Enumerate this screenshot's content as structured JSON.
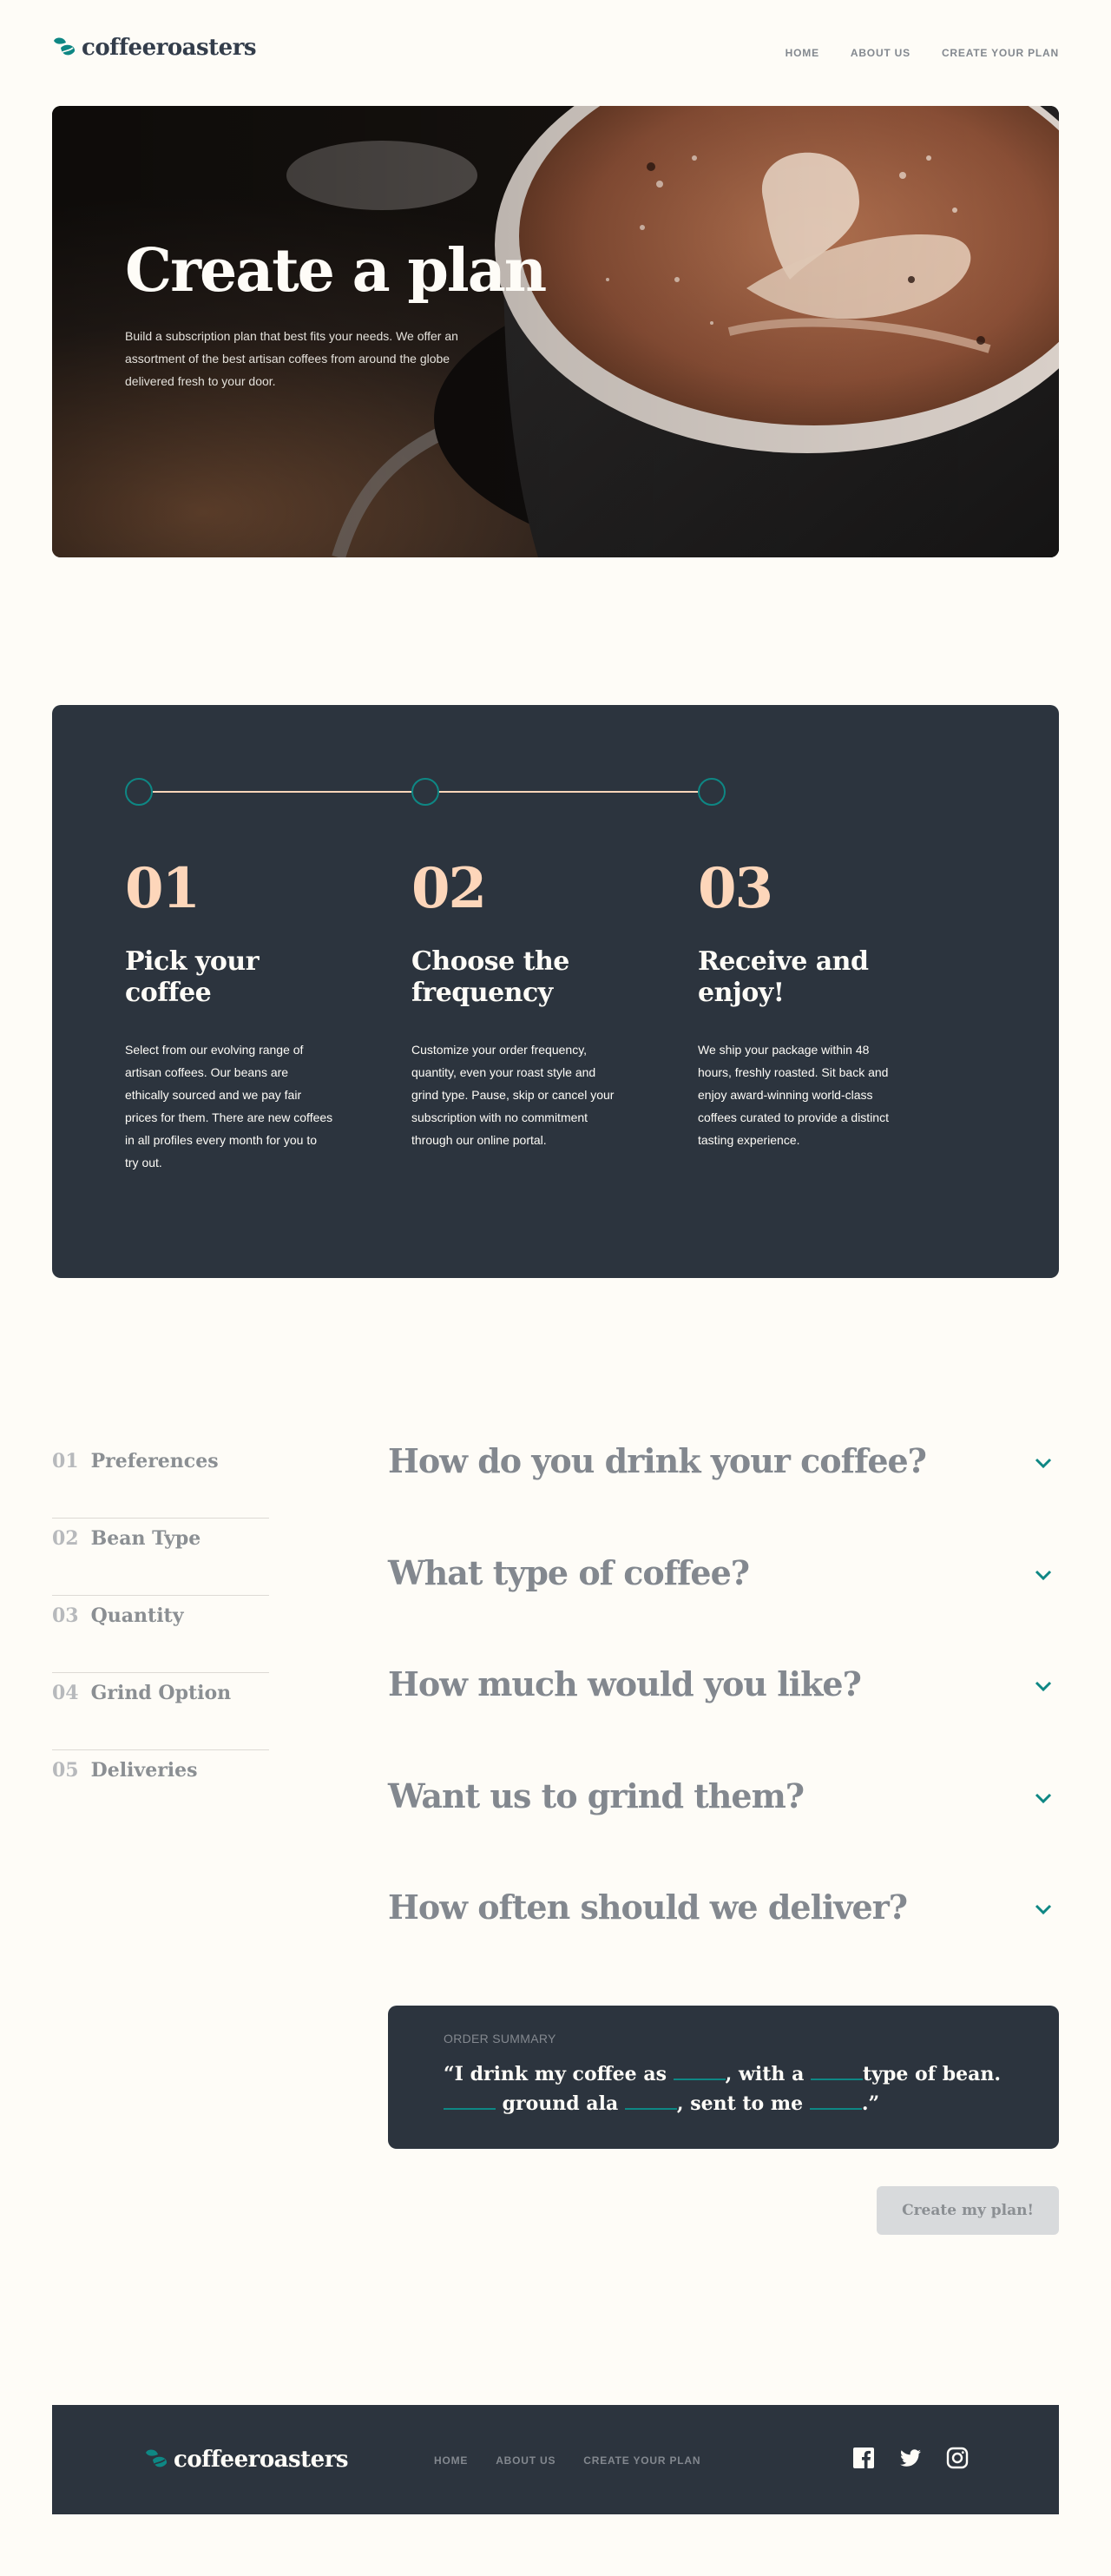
{
  "brand": {
    "name": "coffeeroasters"
  },
  "nav": {
    "home": "HOME",
    "about": "ABOUT US",
    "create": "CREATE YOUR PLAN"
  },
  "hero": {
    "title": "Create a plan",
    "text": "Build a subscription plan that best fits your needs. We offer an assortment of the best artisan coffees from around the globe delivered fresh to your door."
  },
  "steps": [
    {
      "num": "01",
      "title": "Pick your coffee",
      "text": "Select from our evolving range of artisan coffees. Our beans are ethically sourced and we pay fair prices for them. There are new coffees in all profiles every month for you to try out."
    },
    {
      "num": "02",
      "title": "Choose the frequency",
      "text": "Customize your order frequency, quantity, even your roast style and grind type. Pause, skip or cancel your subscription with no commitment through our online portal."
    },
    {
      "num": "03",
      "title": "Receive and enjoy!",
      "text": "We ship your package within 48 hours, freshly roasted. Sit back and enjoy award-winning world-class coffees curated to provide a distinct tasting experience."
    }
  ],
  "sidebar": [
    {
      "num": "01",
      "label": "Preferences"
    },
    {
      "num": "02",
      "label": "Bean Type"
    },
    {
      "num": "03",
      "label": "Quantity"
    },
    {
      "num": "04",
      "label": "Grind Option"
    },
    {
      "num": "05",
      "label": "Deliveries"
    }
  ],
  "questions": [
    {
      "title": "How do you drink your coffee?"
    },
    {
      "title": "What type of coffee?"
    },
    {
      "title": "How much would you like?"
    },
    {
      "title": "Want us to grind them?"
    },
    {
      "title": "How often should we deliver?"
    }
  ],
  "summary": {
    "label": "ORDER SUMMARY",
    "p1": "“I drink my coffee as ",
    "p2": ", with a ",
    "p3": "type of bean.",
    "p4": " ground ala ",
    "p5": ", sent to me ",
    "p6": ".”"
  },
  "cta": {
    "label": "Create my plan!"
  },
  "colors": {
    "accent": "#0E8784",
    "dark": "#2C343E",
    "peach": "#FDD6BA",
    "cream": "#FEFCF7",
    "grey": "#83888F"
  },
  "icons": {
    "logo": "coffee-beans-icon",
    "chevron": "chevron-down-icon",
    "facebook": "facebook-icon",
    "twitter": "twitter-icon",
    "instagram": "instagram-icon"
  }
}
